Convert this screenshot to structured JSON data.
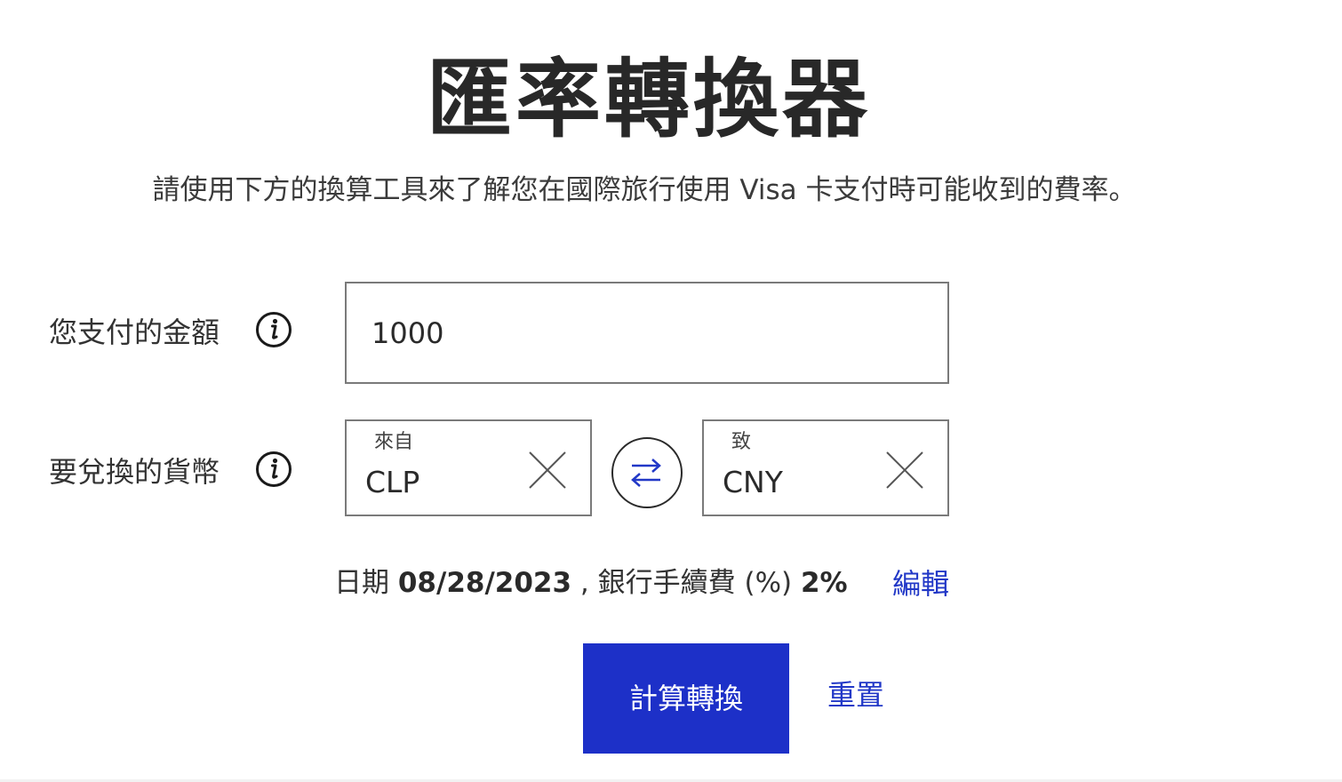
{
  "header": {
    "title": "匯率轉換器",
    "subtitle": "請使用下方的換算工具來了解您在國際旅行使用 Visa 卡支付時可能收到的費率。"
  },
  "form": {
    "amount": {
      "label": "您支付的金額",
      "value": "1000",
      "info_icon": "info-icon"
    },
    "currency": {
      "label": "要兌換的貨幣",
      "info_icon": "info-icon",
      "from": {
        "caption": "來自",
        "value": "CLP",
        "clear_icon": "close-icon"
      },
      "swap_icon": "swap-arrows-icon",
      "to": {
        "caption": "致",
        "value": "CNY",
        "clear_icon": "close-icon"
      }
    },
    "details": {
      "date_label": "日期",
      "date_value": "08/28/2023",
      "separator": " , ",
      "fee_label": "銀行手續費 (%)",
      "fee_value": "2%",
      "edit_label": "編輯"
    },
    "actions": {
      "calculate_label": "計算轉換",
      "reset_label": "重置"
    }
  },
  "colors": {
    "primary_button": "#1d30c8",
    "link": "#2238c7",
    "text": "#2b2b2b",
    "border": "#7a7a7a"
  }
}
